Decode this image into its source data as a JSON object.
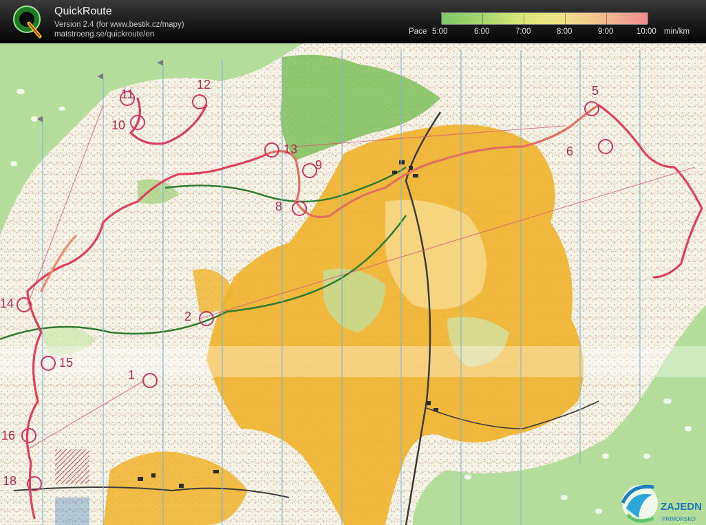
{
  "header": {
    "app_title": "QuickRoute",
    "version_line": "Version 2.4  (for www.bestik.cz/mapy)",
    "url_line": "matstroeng.se/quickroute/en"
  },
  "pace_legend": {
    "label": "Pace",
    "ticks": [
      "5:00",
      "6:00",
      "7:00",
      "8:00",
      "9:00",
      "10:00"
    ],
    "unit": "min/km",
    "colors": [
      "#7cc86a",
      "#a6d86c",
      "#dde879",
      "#f2e08a",
      "#f2b98e",
      "#ef8b8f"
    ]
  },
  "map": {
    "control_labels": [
      "1",
      "2",
      "5",
      "6",
      "8",
      "9",
      "10",
      "11",
      "12",
      "13",
      "14",
      "15",
      "16",
      "18"
    ],
    "watermark": {
      "text": "ZAJEDN",
      "subtext": "PRIMORSKO"
    },
    "colors": {
      "open_land": "#f0b32a",
      "forest": "#f6f3ea",
      "green": "#9fcf78",
      "outside": "#b4dd9c",
      "route": "#e0405a",
      "north_lines": "#7bb6d8"
    }
  }
}
